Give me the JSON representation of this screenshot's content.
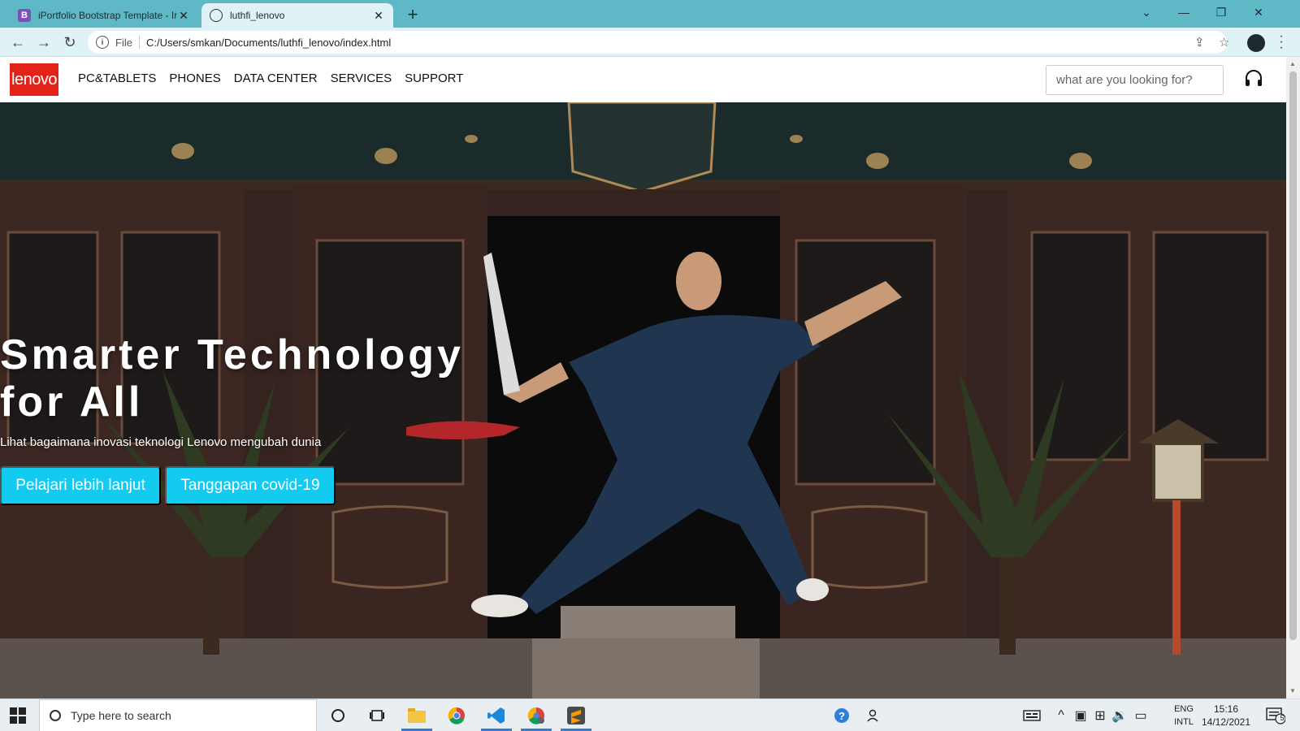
{
  "browser": {
    "tabs": [
      {
        "title": "iPortfolio Bootstrap Template - In",
        "favicon": "bootstrap-icon",
        "active": false
      },
      {
        "title": "luthfi_lenovo",
        "favicon": "globe-icon",
        "active": true
      }
    ],
    "new_tab_label": "+",
    "address": {
      "scheme_label": "File",
      "url": "C:/Users/smkan/Documents/luthfi_lenovo/index.html"
    }
  },
  "site": {
    "logo_text": "lenovo",
    "nav": [
      "PC&TABLETS",
      "PHONES",
      "DATA CENTER",
      "SERVICES",
      "SUPPORT"
    ],
    "search_placeholder": "what are you looking for?",
    "hero": {
      "title": "Smarter Technology for All",
      "subtitle": "Lihat bagaimana inovasi teknologi Lenovo mengubah dunia",
      "button_primary": "Pelajari lebih lanjut",
      "button_secondary": "Tanggapan covid-19"
    }
  },
  "taskbar": {
    "search_placeholder": "Type here to search",
    "language_top": "ENG",
    "language_bottom": "INTL",
    "time": "15:16",
    "date": "14/12/2021",
    "notification_count": "5"
  },
  "colors": {
    "tab_strip": "#5fb8c6",
    "lenovo_red": "#e2231a",
    "hero_button": "#13caf0"
  }
}
